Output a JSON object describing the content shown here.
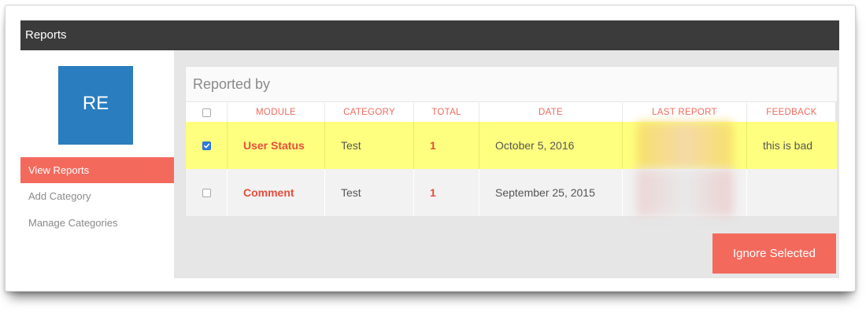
{
  "window": {
    "title": "Reports"
  },
  "sidebar": {
    "avatar_text": "RE",
    "items": [
      {
        "label": "View Reports",
        "active": true
      },
      {
        "label": "Add Category",
        "active": false
      },
      {
        "label": "Manage Categories",
        "active": false
      }
    ]
  },
  "panel": {
    "title": "Reported by",
    "columns": [
      "MODULE",
      "CATEGORY",
      "TOTAL",
      "DATE",
      "LAST REPORT",
      "FEEDBACK"
    ],
    "rows": [
      {
        "checked": true,
        "module": "User Status",
        "category": "Test",
        "total": "1",
        "date": "October 5, 2016",
        "last_report": "",
        "feedback": "this is bad"
      },
      {
        "checked": false,
        "module": "Comment",
        "category": "Test",
        "total": "1",
        "date": "September 25, 2015",
        "last_report": "",
        "feedback": ""
      }
    ]
  },
  "actions": {
    "ignore_label": "Ignore Selected"
  },
  "colors": {
    "accent": "#f36a5d",
    "titlebar": "#3b3b3b",
    "avatar": "#2a7dbe",
    "selected_row": "#ffff7f",
    "link_red": "#e74c3c"
  }
}
